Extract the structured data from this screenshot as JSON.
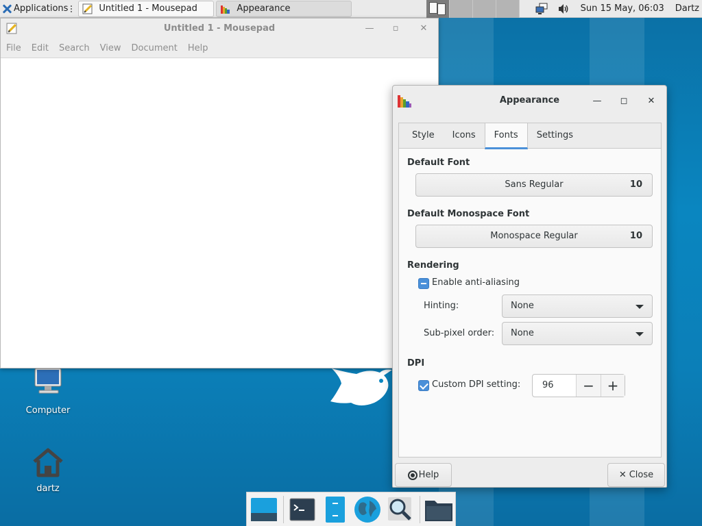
{
  "panel": {
    "applications_label": "Applications",
    "tasks": [
      {
        "label": "Untitled 1 - Mousepad",
        "icon": "mousepad-icon",
        "active": true
      },
      {
        "label": "Appearance",
        "icon": "appearance-icon",
        "active": false
      }
    ],
    "clock": "Sun 15 May, 06:03",
    "user": "Dartz"
  },
  "mousepad": {
    "title": "Untitled 1 - Mousepad",
    "menu": [
      "File",
      "Edit",
      "Search",
      "View",
      "Document",
      "Help"
    ]
  },
  "desktop": {
    "icons": [
      {
        "label": "Computer",
        "icon": "computer-icon"
      },
      {
        "label": "dartz",
        "icon": "home-icon"
      }
    ]
  },
  "appearance": {
    "title": "Appearance",
    "tabs": [
      "Style",
      "Icons",
      "Fonts",
      "Settings"
    ],
    "active_tab": "Fonts",
    "default_font": {
      "heading": "Default Font",
      "name": "Sans Regular",
      "size": "10"
    },
    "monospace_font": {
      "heading": "Default Monospace Font",
      "name": "Monospace Regular",
      "size": "10"
    },
    "rendering": {
      "heading": "Rendering",
      "antialias_label": "Enable anti-aliasing",
      "hinting_label": "Hinting:",
      "hinting_value": "None",
      "subpixel_label": "Sub-pixel order:",
      "subpixel_value": "None"
    },
    "dpi": {
      "heading": "DPI",
      "custom_label": "Custom DPI setting:",
      "value": "96",
      "decrement": "−",
      "increment": "+"
    },
    "help_button": "Help",
    "close_button": "Close"
  },
  "colors": {
    "accent": "#4a90d9",
    "desktop": "#0a86c0"
  }
}
